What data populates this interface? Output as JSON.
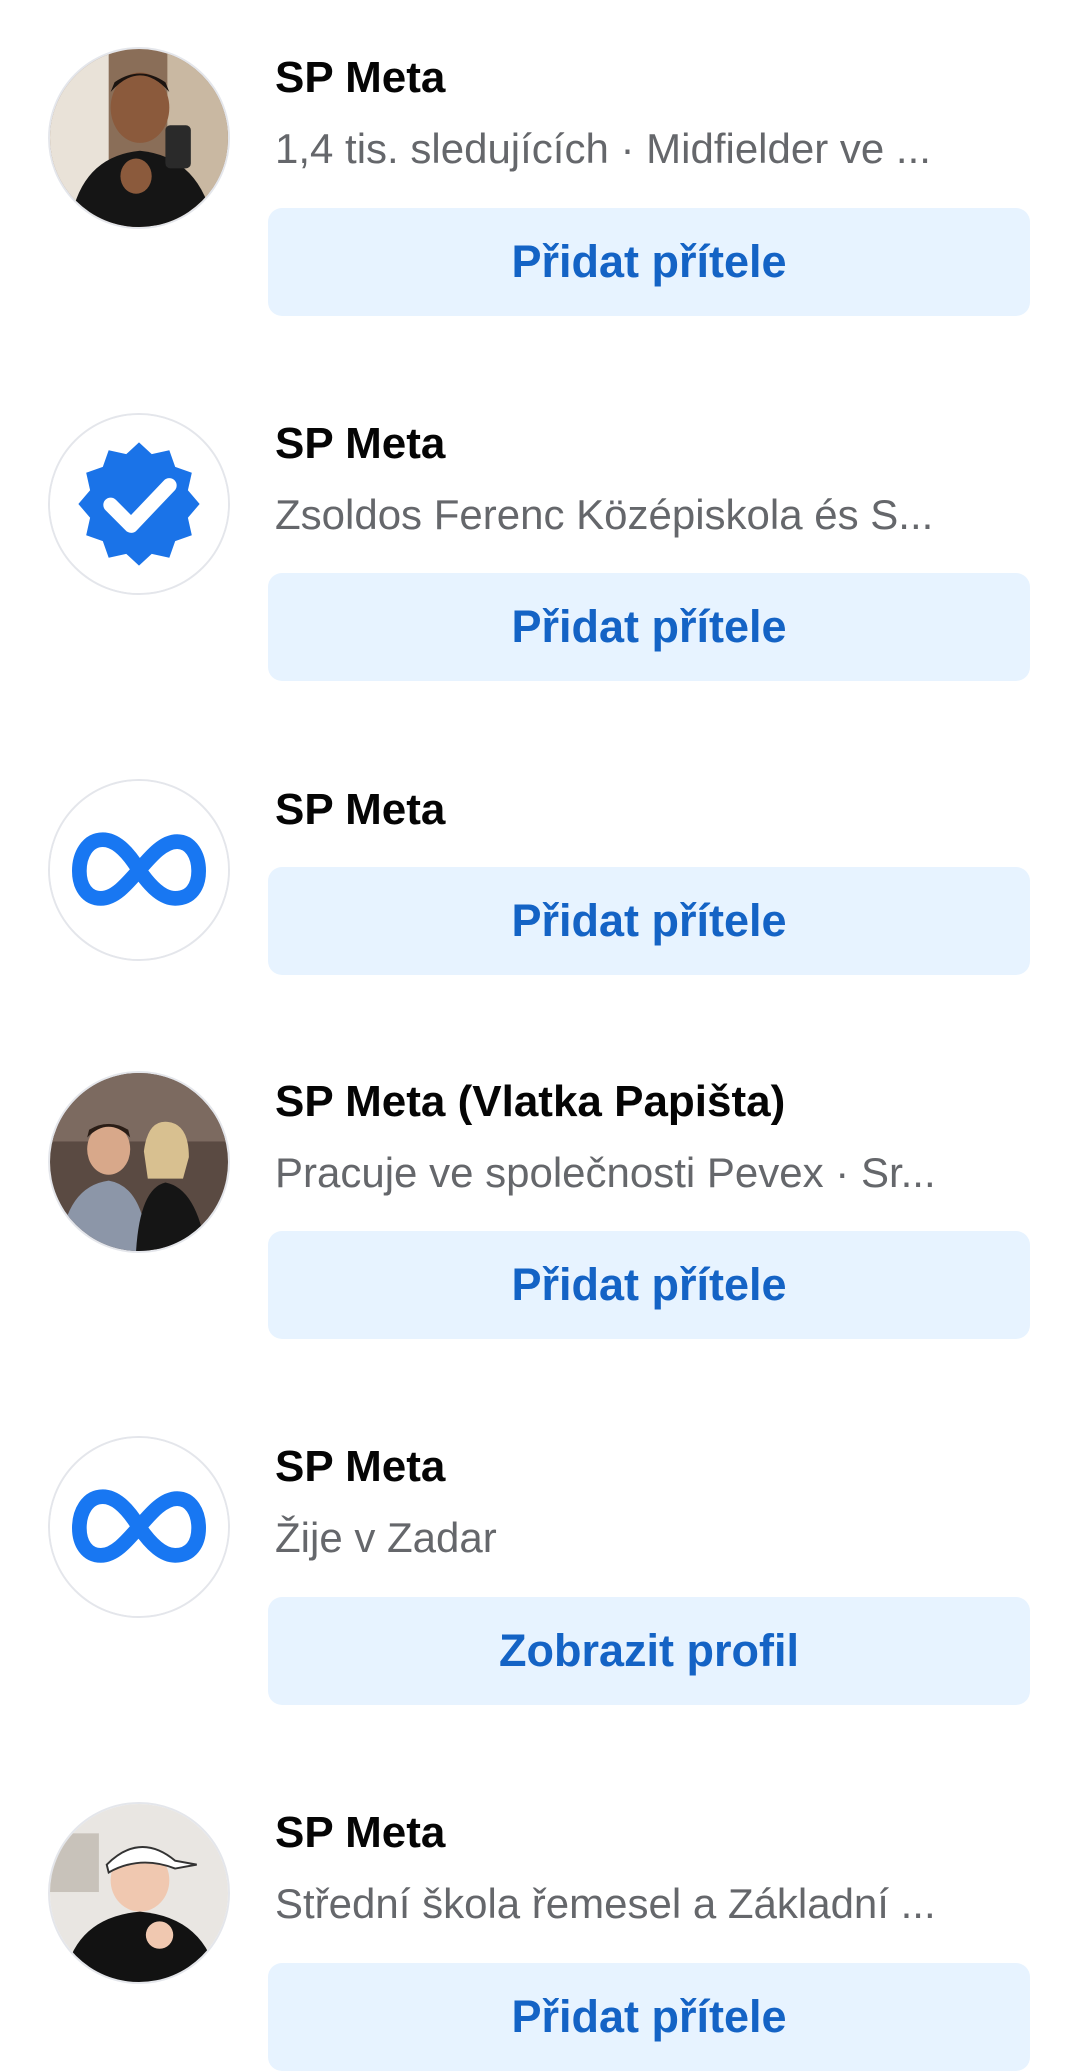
{
  "results": [
    {
      "name": "SP Meta",
      "subtitle": "1,4 tis. sledujících · Midfielder ve ...",
      "button": "Přidat přítele",
      "avatar": "profile-photo-man-selfie"
    },
    {
      "name": "SP Meta",
      "subtitle": "Zsoldos Ferenc Középiskola és S...",
      "button": "Přidat přítele",
      "avatar": "verified-badge-icon"
    },
    {
      "name": "SP Meta",
      "subtitle": "",
      "button": "Přidat přítele",
      "avatar": "meta-logo-icon"
    },
    {
      "name": "SP Meta (Vlatka Papišta)",
      "subtitle": "Pracuje ve společnosti Pevex · Sr...",
      "button": "Přidat přítele",
      "avatar": "profile-photo-couple"
    },
    {
      "name": "SP Meta",
      "subtitle": "Žije v Zadar",
      "button": "Zobrazit profil",
      "avatar": "meta-logo-icon"
    },
    {
      "name": "SP Meta",
      "subtitle": "Střední škola řemesel a Základní ...",
      "button": "Přidat přítele",
      "avatar": "profile-photo-man-cap"
    }
  ],
  "colors": {
    "button_bg": "#e7f3ff",
    "button_text": "#1463c5",
    "name": "#050505",
    "subtitle": "#65676b",
    "meta_blue": "#0866ff"
  }
}
